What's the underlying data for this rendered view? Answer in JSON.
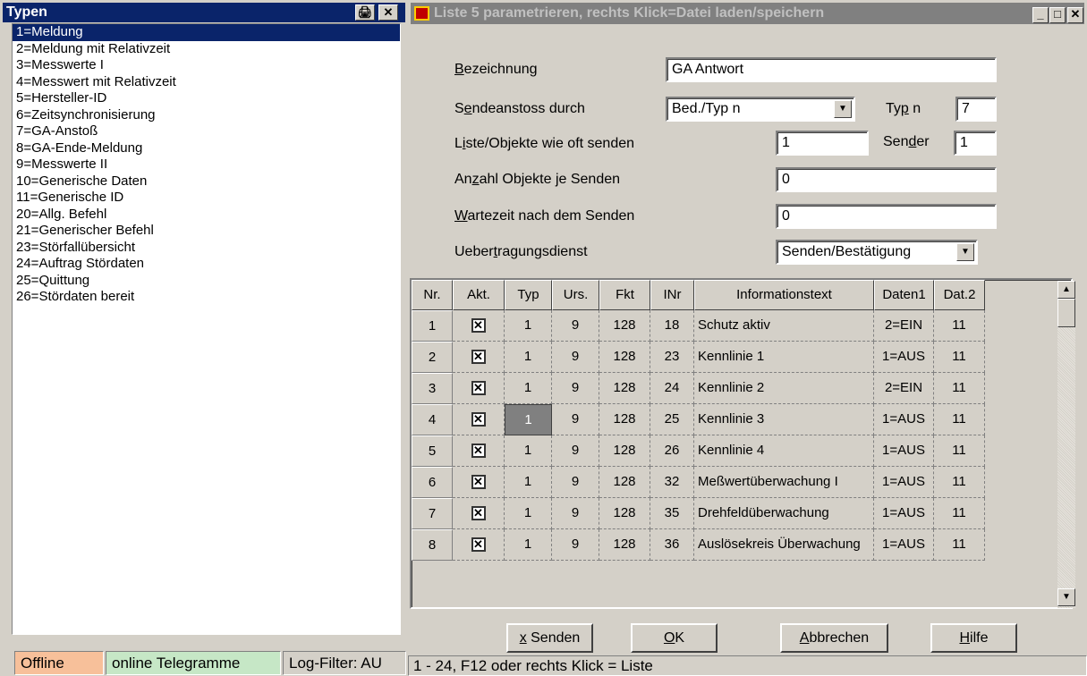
{
  "left": {
    "title": "Typen",
    "items": [
      "1=Meldung",
      "2=Meldung mit Relativzeit",
      "3=Messwerte I",
      "4=Messwert mit Relativzeit",
      "5=Hersteller-ID",
      "6=Zeitsynchronisierung",
      "7=GA-Anstoß",
      "8=GA-Ende-Meldung",
      "9=Messwerte II",
      "10=Generische Daten",
      "11=Generische ID",
      "20=Allg. Befehl",
      "21=Generischer Befehl",
      "23=Störfallübersicht",
      "24=Auftrag Stördaten",
      "25=Quittung",
      "26=Stördaten bereit"
    ],
    "selected_index": 0,
    "status": {
      "offline": "Offline",
      "online": "online Telegramme",
      "logfilter": "Log-Filter: AU"
    },
    "colors": {
      "offline": "#f7c09a",
      "online": "#c6e7c6",
      "selection": "#0a246a"
    }
  },
  "right": {
    "title": "Liste 5 parametrieren, rechts Klick=Datei laden/speichern",
    "form": {
      "bezeichnung_pre": "",
      "bezeichnung_u": "B",
      "bezeichnung_post": "ezeichnung",
      "bezeichnung_value": "GA Antwort",
      "sendeanstoss_pre": "S",
      "sendeanstoss_u": "e",
      "sendeanstoss_post": "ndeanstoss durch",
      "sendeanstoss_value": "Bed./Typ n",
      "typn_pre": "Ty",
      "typn_u": "p",
      "typn_post": " n",
      "typn_value": "7",
      "liste_pre": "L",
      "liste_u": "i",
      "liste_post": "ste/Objekte wie oft senden",
      "liste_value": "1",
      "sender_pre": "Sen",
      "sender_u": "d",
      "sender_post": "er",
      "sender_value": "1",
      "anzahl_pre": "An",
      "anzahl_u": "z",
      "anzahl_post": "ahl Objekte je Senden",
      "anzahl_value": "0",
      "wartezeit_pre": "",
      "wartezeit_u": "W",
      "wartezeit_post": "artezeit nach dem Senden",
      "wartezeit_value": "0",
      "uebertragung_pre": "Ueber",
      "uebertragung_u": "t",
      "uebertragung_post": "ragungsdienst",
      "uebertragung_value": "Senden/Bestätigung"
    },
    "grid": {
      "columns": [
        "Nr.",
        "Akt.",
        "Typ",
        "Urs.",
        "Fkt",
        "INr",
        "Informationstext",
        "Daten1",
        "Dat.2"
      ],
      "rows": [
        [
          "1",
          "☒",
          "1",
          "9",
          "128",
          "18",
          "Schutz aktiv",
          "2=EIN",
          "11"
        ],
        [
          "2",
          "☒",
          "1",
          "9",
          "128",
          "23",
          "Kennlinie 1",
          "1=AUS",
          "11"
        ],
        [
          "3",
          "☒",
          "1",
          "9",
          "128",
          "24",
          "Kennlinie 2",
          "2=EIN",
          "11"
        ],
        [
          "4",
          "☒",
          "1",
          "9",
          "128",
          "25",
          "Kennlinie 3",
          "1=AUS",
          "11"
        ],
        [
          "5",
          "☒",
          "1",
          "9",
          "128",
          "26",
          "Kennlinie 4",
          "1=AUS",
          "11"
        ],
        [
          "6",
          "☒",
          "1",
          "9",
          "128",
          "32",
          "Meßwertüberwachung I",
          "1=AUS",
          "11"
        ],
        [
          "7",
          "☒",
          "1",
          "9",
          "128",
          "35",
          "Drehfeldüberwachung",
          "1=AUS",
          "11"
        ],
        [
          "8",
          "☒",
          "1",
          "9",
          "128",
          "36",
          "Auslösekreis Überwachung",
          "1=AUS",
          "11"
        ]
      ],
      "highlight_row": 3,
      "highlight_col": 2
    },
    "buttons": {
      "senden_u": "x",
      "senden_post": " Senden",
      "ok_u": "O",
      "ok_post": "K",
      "abbrechen_u": "A",
      "abbrechen_post": "bbrechen",
      "hilfe_u": "H",
      "hilfe_post": "ilfe"
    },
    "status": "1 - 24,  F12 oder rechts Klick = Liste"
  }
}
